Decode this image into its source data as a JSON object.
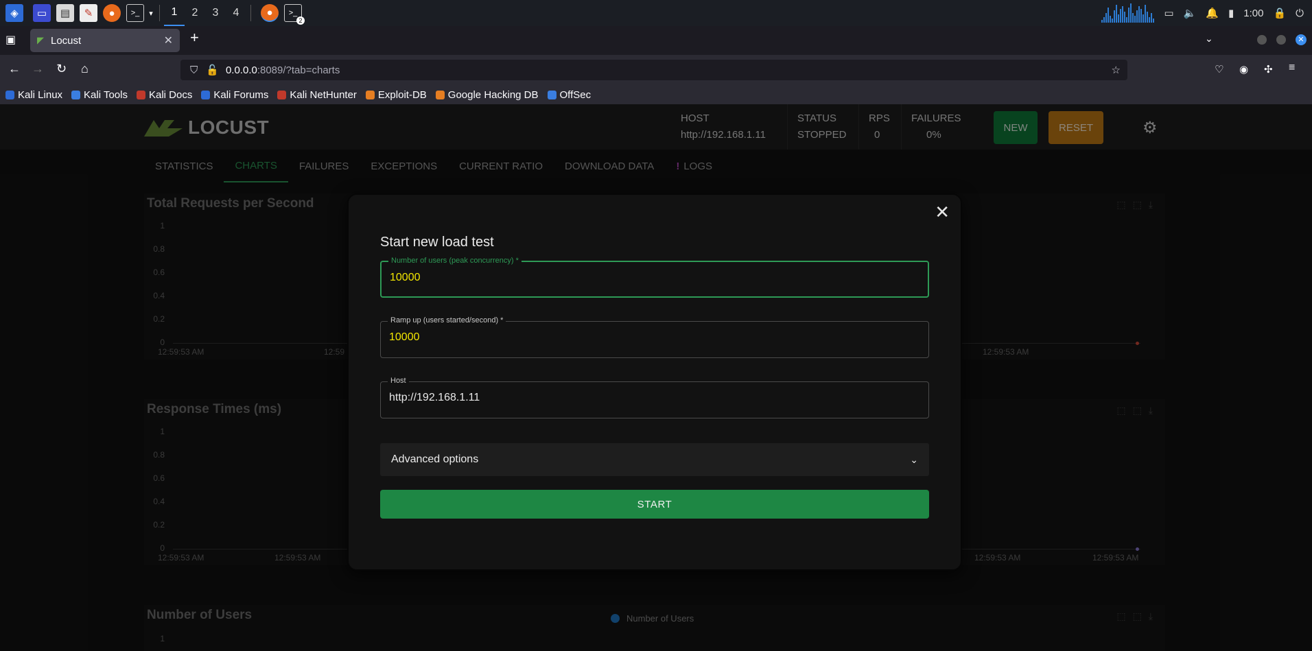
{
  "taskbar": {
    "workspaces": [
      "1",
      "2",
      "3",
      "4"
    ],
    "active_workspace": "1",
    "clock": "1:00",
    "terminal_badge": "2"
  },
  "browser": {
    "tab_title": "Locust",
    "url_host": "0.0.0.0",
    "url_path": ":8089/?tab=charts",
    "bookmarks": [
      {
        "label": "Kali Linux",
        "color": "#2d6bd6"
      },
      {
        "label": "Kali Tools",
        "color": "#3a7ee0"
      },
      {
        "label": "Kali Docs",
        "color": "#c0392b"
      },
      {
        "label": "Kali Forums",
        "color": "#2d6bd6"
      },
      {
        "label": "Kali NetHunter",
        "color": "#c0392b"
      },
      {
        "label": "Exploit-DB",
        "color": "#e67e22"
      },
      {
        "label": "Google Hacking DB",
        "color": "#e67e22"
      },
      {
        "label": "OffSec",
        "color": "#3a7ee0"
      }
    ]
  },
  "locust": {
    "logo_text": "LOCUST",
    "host_label": "HOST",
    "host_value": "http://192.168.1.11",
    "status_label": "STATUS",
    "status_value": "STOPPED",
    "rps_label": "RPS",
    "rps_value": "0",
    "failures_label": "FAILURES",
    "failures_value": "0%",
    "new_button": "NEW",
    "reset_button": "RESET",
    "tabs": [
      "STATISTICS",
      "CHARTS",
      "FAILURES",
      "EXCEPTIONS",
      "CURRENT RATIO",
      "DOWNLOAD DATA",
      "LOGS"
    ],
    "active_tab": "CHARTS",
    "charts": [
      {
        "title": "Total Requests per Second",
        "yticks": [
          "1",
          "0.8",
          "0.6",
          "0.4",
          "0.2",
          "0"
        ],
        "xticks": [
          "12:59:53 AM",
          "12:59",
          "12:59:53 AM"
        ],
        "dot_color": "#d04a3a"
      },
      {
        "title": "Response Times (ms)",
        "yticks": [
          "1",
          "0.8",
          "0.6",
          "0.4",
          "0.2",
          "0"
        ],
        "xticks": [
          "12:59:53 AM",
          "12:59:53 AM",
          "12:59:53 AM",
          "12:59:53 AM"
        ],
        "dot_color": "#8a7ad6"
      },
      {
        "title": "Number of Users",
        "legend": "Number of Users",
        "legend_color": "#1f77c4",
        "yticks": [
          "1"
        ]
      }
    ]
  },
  "modal": {
    "title": "Start new load test",
    "users_label": "Number of users (peak concurrency) *",
    "users_value": "10000",
    "ramp_label": "Ramp up (users started/second) *",
    "ramp_value": "10000",
    "host_label": "Host",
    "host_value": "http://192.168.1.11",
    "advanced_label": "Advanced options",
    "start_button": "START"
  }
}
